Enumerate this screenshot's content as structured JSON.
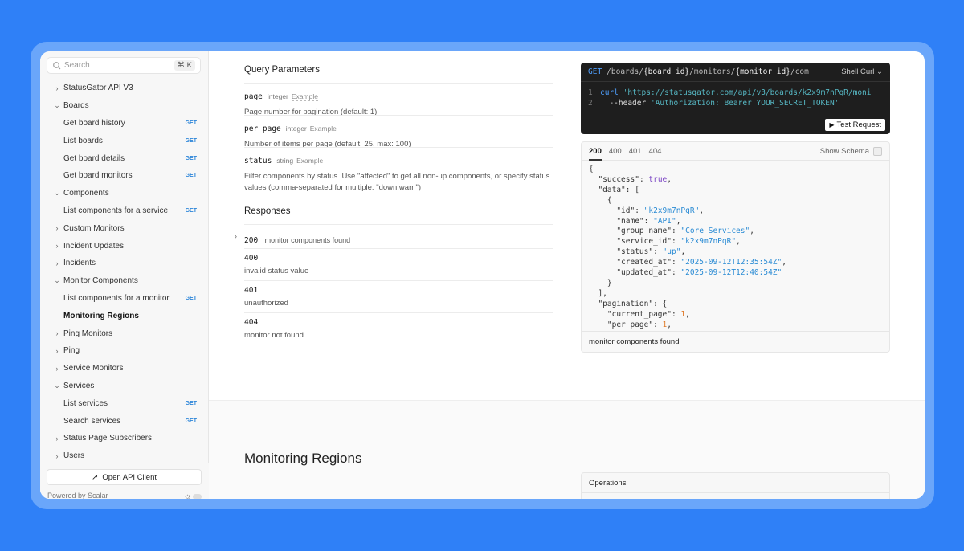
{
  "sidebar": {
    "search_placeholder": "Search",
    "search_shortcut": "⌘ K",
    "items": [
      {
        "label": "StatusGator API V3",
        "chevron": "›",
        "child": false,
        "get": ""
      },
      {
        "label": "Boards",
        "chevron": "⌄",
        "child": false,
        "get": ""
      },
      {
        "label": "Get board history",
        "chevron": "",
        "child": true,
        "get": "GET"
      },
      {
        "label": "List boards",
        "chevron": "",
        "child": true,
        "get": "GET"
      },
      {
        "label": "Get board details",
        "chevron": "",
        "child": true,
        "get": "GET"
      },
      {
        "label": "Get board monitors",
        "chevron": "",
        "child": true,
        "get": "GET"
      },
      {
        "label": "Components",
        "chevron": "⌄",
        "child": false,
        "get": ""
      },
      {
        "label": "List components for a service",
        "chevron": "",
        "child": true,
        "get": "GET"
      },
      {
        "label": "Custom Monitors",
        "chevron": "›",
        "child": false,
        "get": ""
      },
      {
        "label": "Incident Updates",
        "chevron": "›",
        "child": false,
        "get": ""
      },
      {
        "label": "Incidents",
        "chevron": "›",
        "child": false,
        "get": ""
      },
      {
        "label": "Monitor Components",
        "chevron": "⌄",
        "child": false,
        "get": ""
      },
      {
        "label": "List components for a monitor",
        "chevron": "",
        "child": true,
        "get": "GET"
      },
      {
        "label": "Monitoring Regions",
        "chevron": "",
        "child": true,
        "get": "",
        "active": true
      },
      {
        "label": "Ping Monitors",
        "chevron": "›",
        "child": false,
        "get": ""
      },
      {
        "label": "Ping",
        "chevron": "›",
        "child": false,
        "get": ""
      },
      {
        "label": "Service Monitors",
        "chevron": "›",
        "child": false,
        "get": ""
      },
      {
        "label": "Services",
        "chevron": "⌄",
        "child": false,
        "get": ""
      },
      {
        "label": "List services",
        "chevron": "",
        "child": true,
        "get": "GET"
      },
      {
        "label": "Search services",
        "chevron": "",
        "child": true,
        "get": "GET"
      },
      {
        "label": "Status Page Subscribers",
        "chevron": "›",
        "child": false,
        "get": ""
      },
      {
        "label": "Users",
        "chevron": "›",
        "child": false,
        "get": ""
      }
    ],
    "open_client": "Open API Client",
    "powered_by": "Powered by Scalar"
  },
  "query": {
    "heading": "Query Parameters",
    "params": [
      {
        "name": "page",
        "type": "integer",
        "example": "Example",
        "desc": "Page number for pagination (default: 1)"
      },
      {
        "name": "per_page",
        "type": "integer",
        "example": "Example",
        "desc": "Number of items per page (default: 25, max: 100)"
      },
      {
        "name": "status",
        "type": "string",
        "example": "Example",
        "desc": "Filter components by status. Use \"affected\" to get all non-up components, or specify status values (comma-separated for multiple: \"down,warn\")"
      }
    ]
  },
  "responses": {
    "heading": "Responses",
    "items": [
      {
        "code": "200",
        "desc": "monitor components found"
      },
      {
        "code": "400",
        "desc": "invalid status value"
      },
      {
        "code": "401",
        "desc": "unauthorized"
      },
      {
        "code": "404",
        "desc": "monitor not found"
      }
    ]
  },
  "code_panel": {
    "method": "GET",
    "path_1": "/boards/",
    "path_2": "{board_id}",
    "path_3": "/monitors/",
    "path_4": "{monitor_id}",
    "path_5": "/com",
    "lang": "Shell Curl",
    "line1_kw": "curl",
    "line1_url": "'https://statusgator.com/api/v3/boards/k2x9m7nPqR/moni",
    "line2_flag": "--header",
    "line2_val": "'Authorization: Bearer YOUR_SECRET_TOKEN'",
    "test_button": "Test Request"
  },
  "response_panel": {
    "tabs": [
      "200",
      "400",
      "401",
      "404"
    ],
    "show_schema": "Show Schema",
    "footer": "monitor components found",
    "json": {
      "success": "true",
      "id": "\"k2x9m7nPqR\"",
      "name": "\"API\"",
      "group_name": "\"Core Services\"",
      "service_id": "\"k2x9m7nPqR\"",
      "status": "\"up\"",
      "created_at": "\"2025-09-12T12:35:54Z\"",
      "updated_at": "\"2025-09-12T12:40:54Z\"",
      "current_page": "1",
      "per_page": "1"
    }
  },
  "lower": {
    "title": "Monitoring Regions",
    "operations": "Operations"
  }
}
